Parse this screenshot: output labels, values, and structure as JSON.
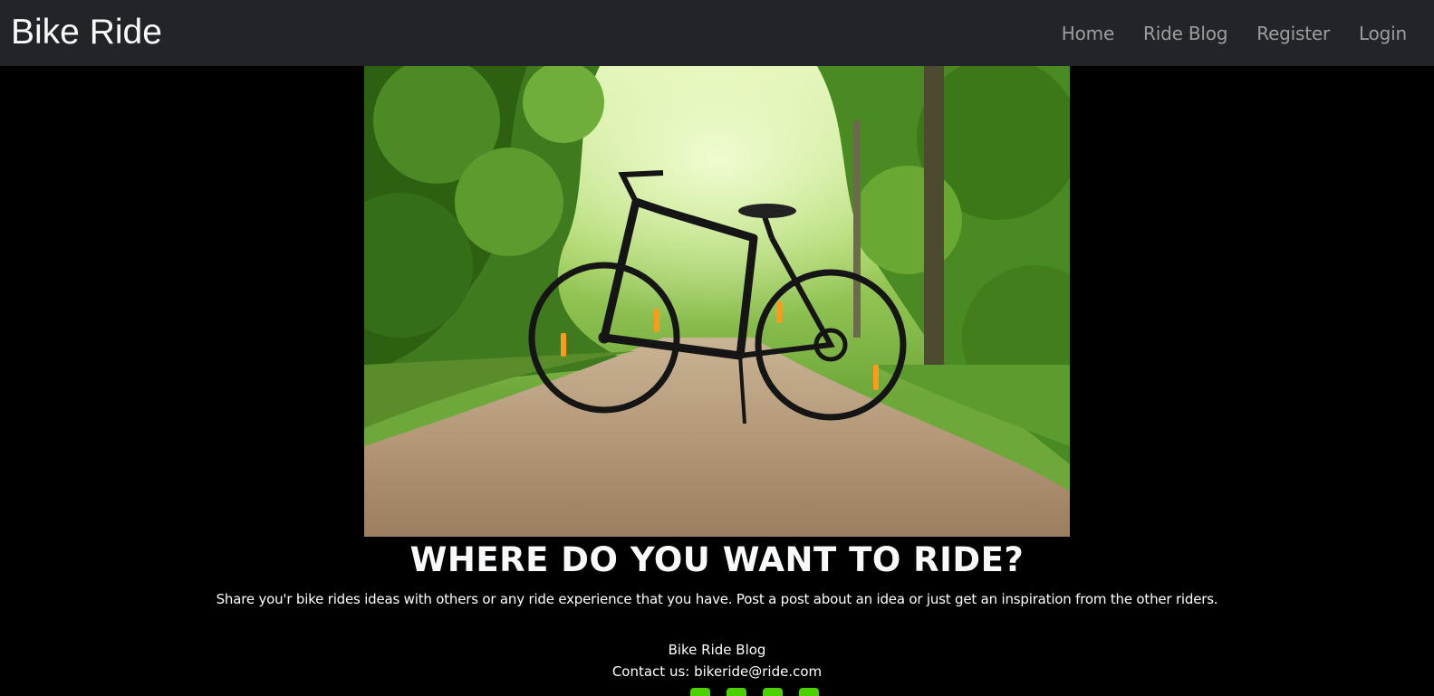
{
  "navbar": {
    "brand": "Bike Ride",
    "links": [
      "Home",
      "Ride Blog",
      "Register",
      "Login"
    ]
  },
  "hero": {
    "image_alt": "bicycle on a forest trail"
  },
  "main": {
    "title": "WHERE DO YOU WANT TO RIDE?",
    "lead": "Share you'r bike rides ideas with others or any ride experience that you have. Post a post about an idea or just get an inspiration from the other riders."
  },
  "footer": {
    "title": "Bike Ride Blog",
    "contact": "Contact us: bikeride@ride.com",
    "social_icons": [
      "facebook-icon",
      "twitter-icon",
      "instagram-icon",
      "youtube-icon"
    ],
    "icon_color": "#4cd000"
  },
  "colors": {
    "navbar_bg": "#212529",
    "page_bg": "#000000"
  }
}
